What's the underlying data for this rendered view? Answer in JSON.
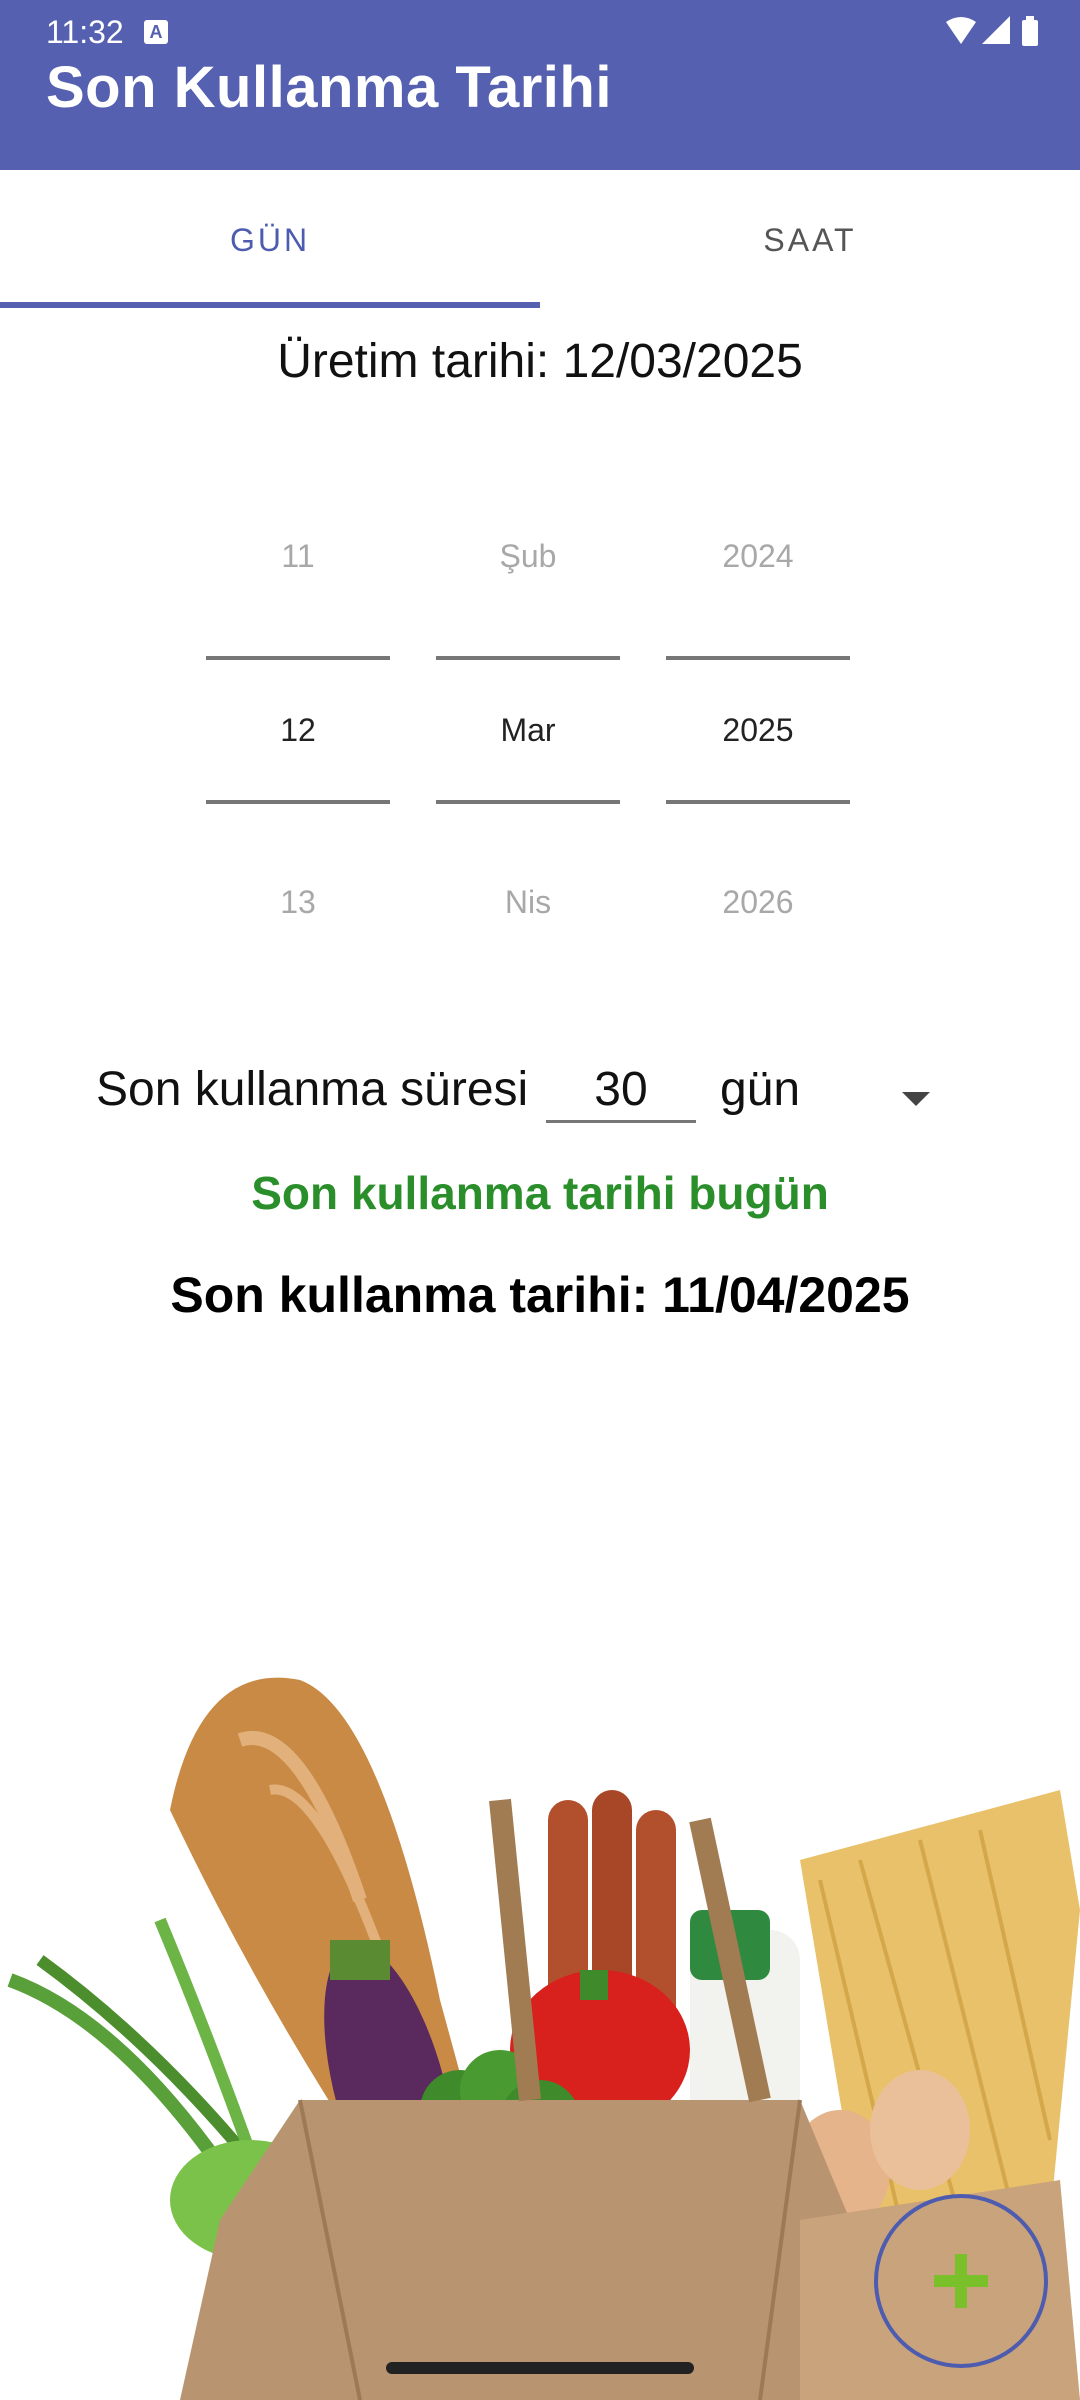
{
  "status_bar": {
    "time": "11:32",
    "notification_glyph": "A"
  },
  "app_bar": {
    "title": "Son Kullanma Tarihi"
  },
  "tabs": [
    {
      "label": "GÜN"
    },
    {
      "label": "SAAT"
    }
  ],
  "production": {
    "text": "Üretim tarihi: 12/03/2025"
  },
  "date_picker": {
    "day": {
      "prev": "11",
      "current": "12",
      "next": "13"
    },
    "month": {
      "prev": "Şub",
      "current": "Mar",
      "next": "Nis"
    },
    "year": {
      "prev": "2024",
      "current": "2025",
      "next": "2026"
    }
  },
  "duration": {
    "label": "Son kullanma süresi",
    "value": "30",
    "unit": "gün"
  },
  "status_message": "Son kullanma tarihi bugün",
  "expiry": {
    "text": "Son kullanma tarihi: 11/04/2025"
  },
  "colors": {
    "primary": "#5561b0",
    "success": "#2a8f2a",
    "fab_icon": "#7ac02a"
  },
  "icons": [
    "wifi-icon",
    "signal-icon",
    "battery-icon",
    "plus-icon"
  ]
}
